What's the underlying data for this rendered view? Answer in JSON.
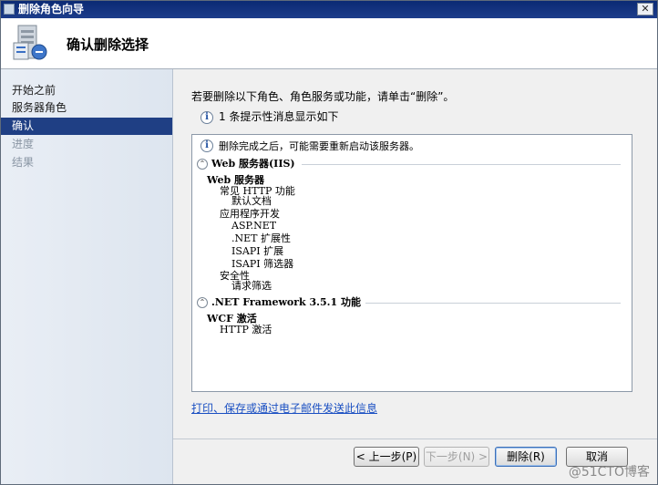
{
  "window": {
    "title": "删除角色向导",
    "close_label": "✕"
  },
  "header": {
    "title": "确认删除选择"
  },
  "sidebar": {
    "items": [
      {
        "label": "开始之前",
        "state": "normal"
      },
      {
        "label": "服务器角色",
        "state": "normal"
      },
      {
        "label": "确认",
        "state": "active"
      },
      {
        "label": "进度",
        "state": "disabled"
      },
      {
        "label": "结果",
        "state": "disabled"
      }
    ]
  },
  "main": {
    "instruction": "若要删除以下角色、角色服务或功能，请单击“删除”。",
    "info_message": "1 条提示性消息显示如下",
    "results": {
      "notice": "删除完成之后，可能需要重新启动该服务器。",
      "section1_title": "Web 服务器(IIS)",
      "section1_group": "Web 服务器",
      "l1": "常见 HTTP 功能",
      "l2": "默认文档",
      "l3": "应用程序开发",
      "l4": "ASP.NET",
      "l5": ".NET 扩展性",
      "l6": "ISAPI 扩展",
      "l7": "ISAPI 筛选器",
      "l8": "安全性",
      "l9": "请求筛选",
      "section2_title": ".NET Framework 3.5.1 功能",
      "section2_group": "WCF 激活",
      "l10": "HTTP 激活"
    },
    "link": "打印、保存或通过电子邮件发送此信息"
  },
  "footer": {
    "prev": "< 上一步(P)",
    "next": "下一步(N) >",
    "remove": "删除(R)",
    "cancel": "取消"
  },
  "watermark": "@51CTO博客",
  "colors": {
    "titlebar": "#0b2a74",
    "active_nav": "#1f3f84",
    "link": "#1a4fc2"
  }
}
